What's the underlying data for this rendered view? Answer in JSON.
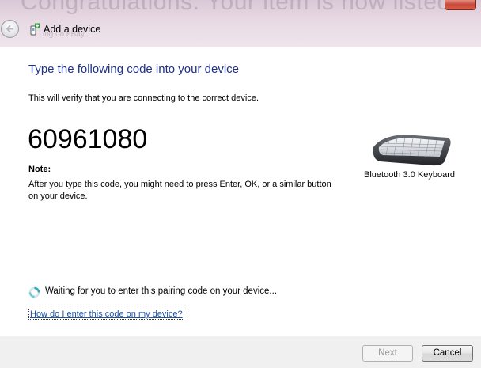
{
  "window": {
    "background_text": "Congratulations. Your item is now listed",
    "background_subtext": "ing on eBay",
    "title": "Add a device"
  },
  "main": {
    "instruction": "Type the following code into your device",
    "verify_text": "This will verify that you are connecting to the correct device.",
    "pairing_code": "60961080",
    "note_label": "Note:",
    "note_body": "After you type this code, you might need to press Enter, OK, or a similar button on your device.",
    "device_name": "Bluetooth 3.0 Keyboard",
    "waiting_text": "Waiting for you to enter this pairing code on your device...",
    "help_link": "How do I enter this code on my device?"
  },
  "footer": {
    "next_label": "Next",
    "next_enabled": false,
    "cancel_label": "Cancel"
  },
  "icons": {
    "back": "back-arrow-icon",
    "wizard": "add-device-icon",
    "device": "keyboard-icon",
    "spinner": "busy-spinner-icon",
    "close": "close-icon"
  },
  "colors": {
    "instruction_text": "#1e3287",
    "link": "#1c55a8",
    "footer_bg": "#f0f0f0",
    "titlebar": "#e8dae4"
  }
}
